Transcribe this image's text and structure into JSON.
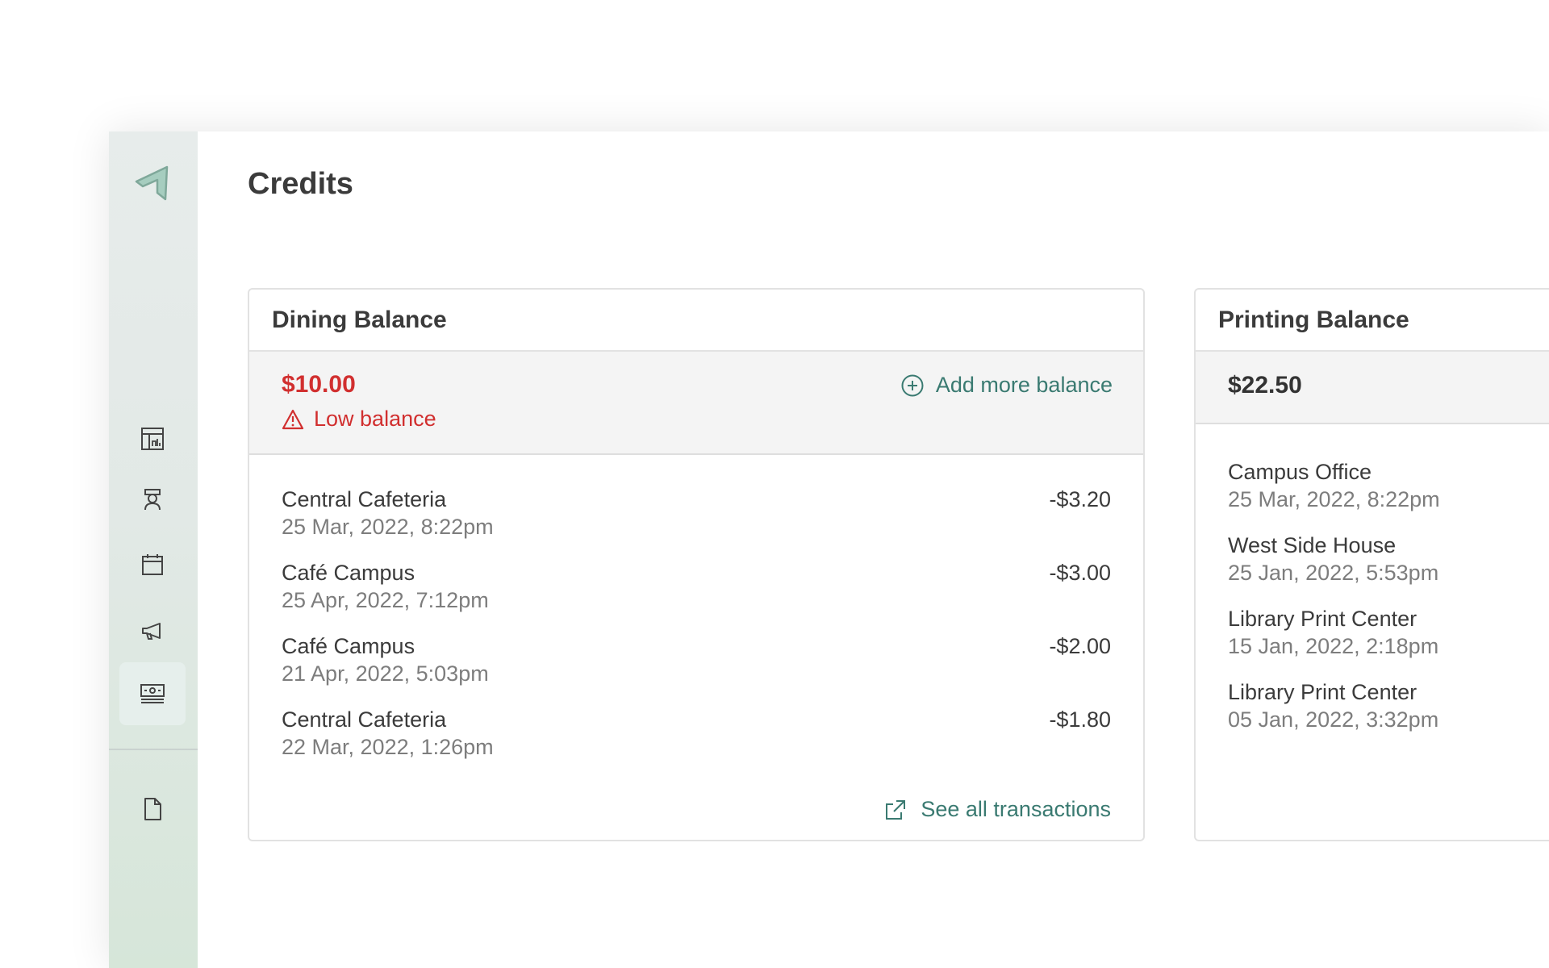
{
  "page": {
    "title": "Credits"
  },
  "sidebar": {
    "items": [
      {
        "name": "dashboard",
        "icon": "dashboard-chart-icon"
      },
      {
        "name": "dining",
        "icon": "chef-icon"
      },
      {
        "name": "calendar",
        "icon": "calendar-icon"
      },
      {
        "name": "announcements",
        "icon": "megaphone-icon"
      },
      {
        "name": "credits",
        "icon": "money-icon",
        "active": true
      },
      {
        "name": "documents",
        "icon": "document-icon"
      }
    ]
  },
  "dining": {
    "title": "Dining Balance",
    "amount": "$10.00",
    "warning": "Low balance",
    "add_label": "Add more balance",
    "transactions": [
      {
        "name": "Central Cafeteria",
        "date": "25 Mar, 2022, 8:22pm",
        "amount": "-$3.20"
      },
      {
        "name": "Café Campus",
        "date": "25 Apr, 2022, 7:12pm",
        "amount": "-$3.00"
      },
      {
        "name": "Café Campus",
        "date": "21 Apr, 2022, 5:03pm",
        "amount": "-$2.00"
      },
      {
        "name": "Central Cafeteria",
        "date": "22 Mar, 2022, 1:26pm",
        "amount": "-$1.80"
      }
    ],
    "see_all_label": "See all transactions"
  },
  "printing": {
    "title": "Printing Balance",
    "amount": "$22.50",
    "transactions": [
      {
        "name": "Campus Office",
        "date": "25 Mar, 2022, 8:22pm"
      },
      {
        "name": "West Side House",
        "date": "25 Jan, 2022, 5:53pm"
      },
      {
        "name": "Library Print Center",
        "date": "15 Jan, 2022, 2:18pm"
      },
      {
        "name": "Library Print Center",
        "date": "05 Jan, 2022, 3:32pm"
      }
    ]
  },
  "colors": {
    "accent": "#3a7a71",
    "danger": "#d12f2f",
    "logo": "#8fbfae"
  }
}
